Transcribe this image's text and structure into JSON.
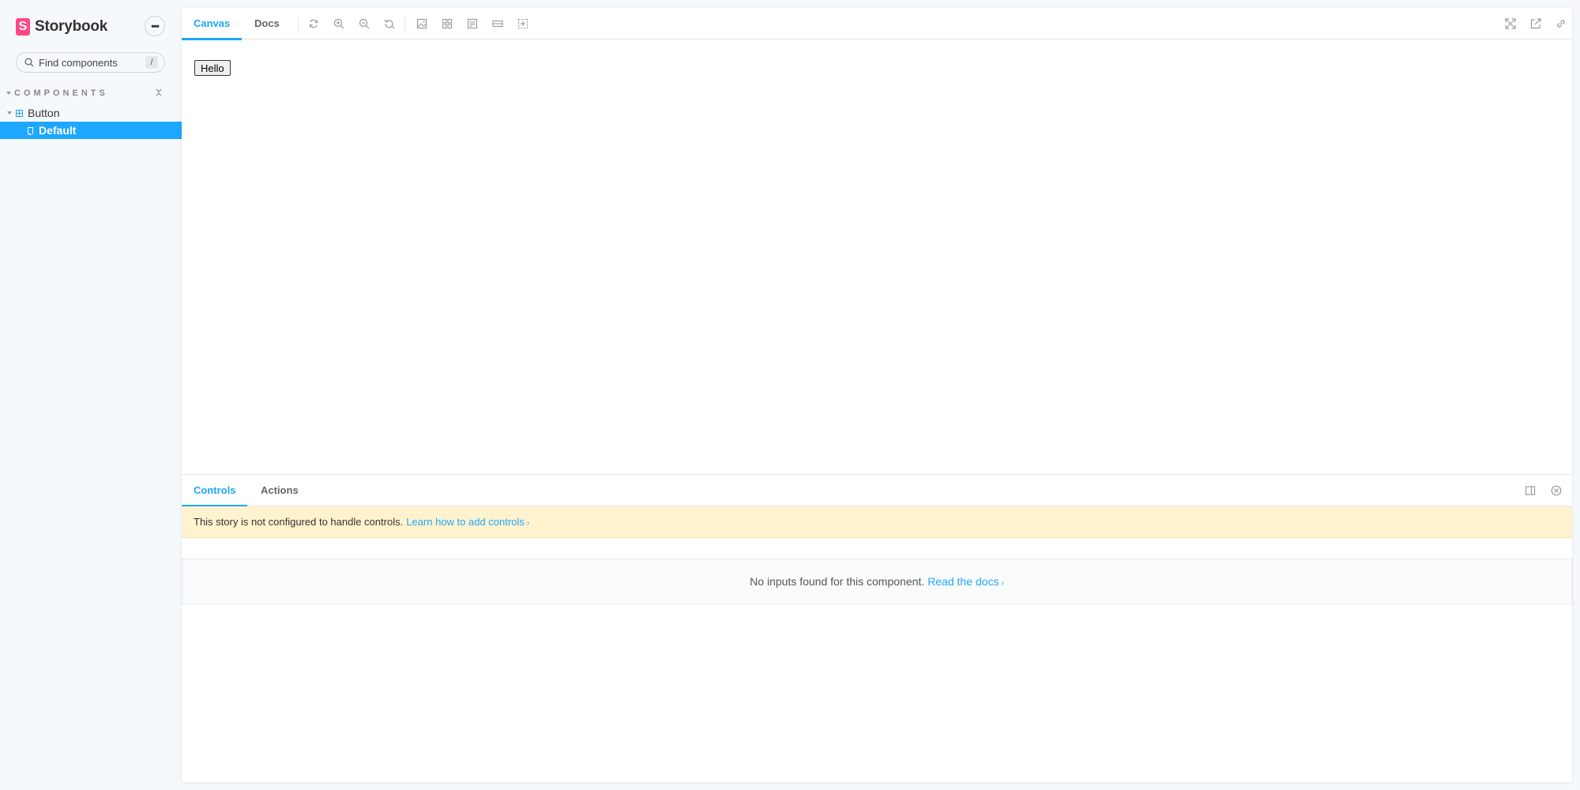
{
  "brand": {
    "logo_letter": "S",
    "name": "Storybook"
  },
  "menu": {
    "icon": "ellipsis-icon",
    "label": "•••"
  },
  "search": {
    "placeholder": "Find components",
    "shortcut": "/"
  },
  "sidebar": {
    "section_title": "COMPONENTS",
    "component": "Button",
    "story": "Default",
    "selected_color": "#1ea7fd"
  },
  "toolbar": {
    "tabs": [
      {
        "label": "Canvas",
        "active": true
      },
      {
        "label": "Docs",
        "active": false
      }
    ],
    "tools": [
      "reload-icon",
      "zoom-in-icon",
      "zoom-out-icon",
      "zoom-reset-icon",
      "background-icon",
      "grid-icon",
      "viewport-icon",
      "measure-icon",
      "outline-icon"
    ],
    "right_tools": [
      "fullscreen-icon",
      "open-new-tab-icon",
      "copy-link-icon"
    ]
  },
  "preview": {
    "button_label": "Hello"
  },
  "addons": {
    "tabs": [
      {
        "label": "Controls",
        "active": true
      },
      {
        "label": "Actions",
        "active": false
      }
    ],
    "warning_text": "This story is not configured to handle controls.",
    "warning_link": "Learn how to add controls",
    "empty_text": "No inputs found for this component.",
    "empty_link": "Read the docs"
  },
  "colors": {
    "accent": "#1ea7fd",
    "brand": "#ff4785",
    "warning_bg": "#fff3cf"
  }
}
